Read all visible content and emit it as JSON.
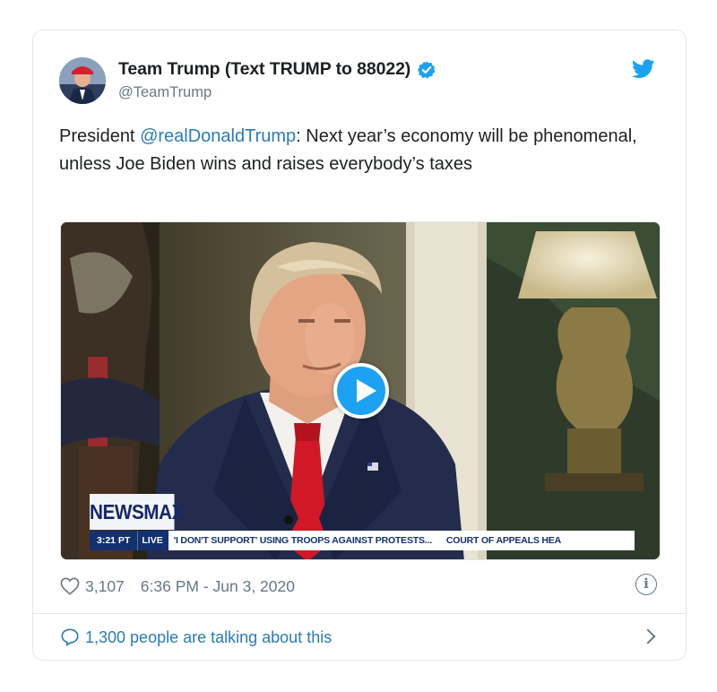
{
  "tweet": {
    "author": {
      "display_name": "Team Trump (Text TRUMP to 88022)",
      "handle": "@TeamTrump",
      "verified": true
    },
    "text": {
      "prefix": "President ",
      "mention": "@realDonaldTrump",
      "suffix": ": Next year’s economy will be phenomenal, unless Joe Biden wins and raises everybody’s taxes"
    },
    "media": {
      "type": "video",
      "overlay": {
        "logo": "NEWSMAX",
        "time": "3:21 PT",
        "live": "LIVE",
        "headline": "'I DON'T SUPPORT' USING TROOPS AGAINST PROTESTS...",
        "headline2": "COURT OF APPEALS HEA"
      }
    },
    "likes": "3,107",
    "timestamp": "6:36 PM - Jun 3, 2020",
    "conversation": "1,300 people are talking about this"
  },
  "icons": {
    "bird": "twitter-bird-icon",
    "verified": "verified-badge-icon",
    "heart": "heart-icon",
    "info": "info-icon",
    "bubble": "speech-bubble-icon",
    "chevron": "chevron-right-icon",
    "play": "play-icon"
  },
  "colors": {
    "brand_blue": "#1da1f2",
    "link_blue": "#2b7bb9",
    "muted": "#697882",
    "border": "#e1e8ed"
  }
}
